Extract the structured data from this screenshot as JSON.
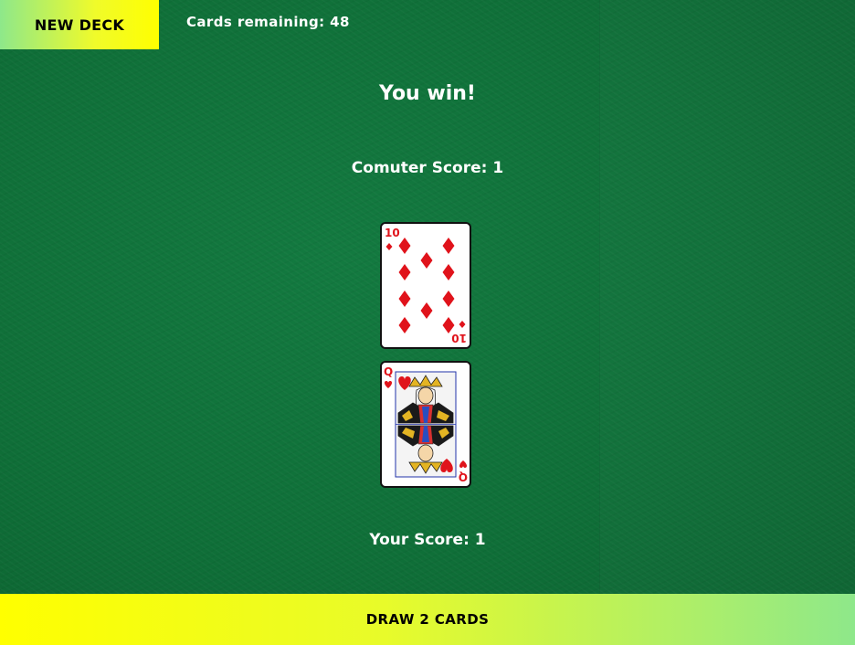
{
  "header": {
    "new_deck_label": "NEW DECK",
    "remaining_label": "Cards remaining: 48"
  },
  "game": {
    "result_text": "You win!",
    "computer_score_label": "Comuter Score: 1",
    "player_score_label": "Your Score: 1"
  },
  "cards": {
    "computer": {
      "rank": "10",
      "suit": "diamonds",
      "suit_icon": "diamond-icon"
    },
    "player": {
      "rank": "Q",
      "suit": "hearts",
      "suit_icon": "heart-icon"
    }
  },
  "footer": {
    "draw_label": "DRAW 2 CARDS"
  },
  "colors": {
    "felt": "#0f6f38",
    "button_yellow": "#ffff00",
    "button_green": "#8ee88a",
    "suit_red": "#e0131b",
    "text": "#ffffff"
  }
}
